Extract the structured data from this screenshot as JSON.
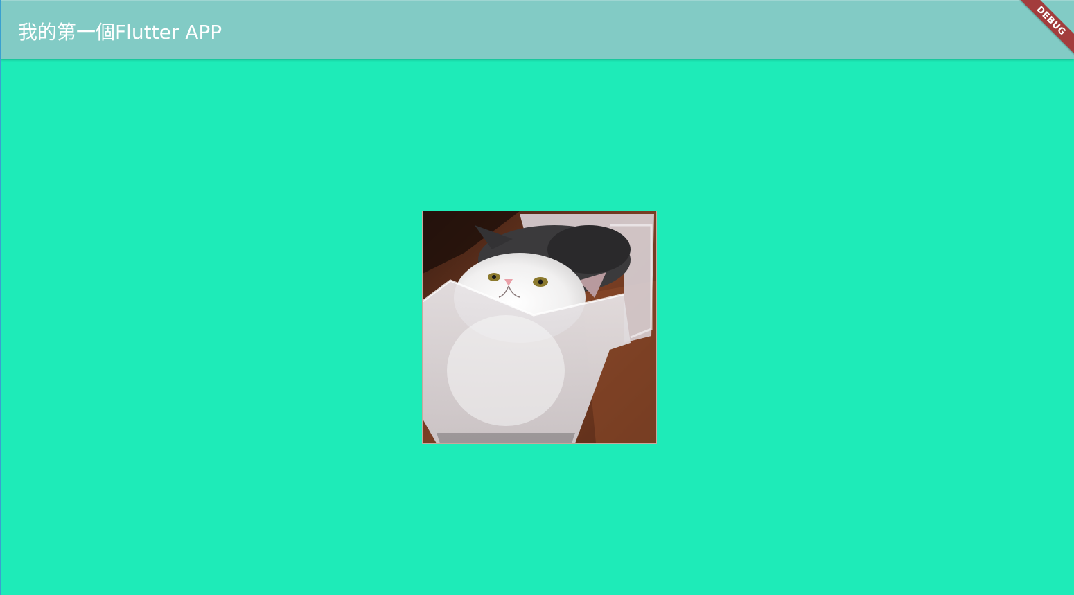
{
  "appbar": {
    "title": "我的第一個Flutter APP"
  },
  "debug_banner": {
    "label": "DEBUG"
  },
  "main": {
    "image": {
      "alt": "cat in a plastic box",
      "icon": "cat-photo"
    }
  },
  "colors": {
    "background": "#1eebb8",
    "appbar": "#82cbc5",
    "banner": "#a33c3c"
  }
}
